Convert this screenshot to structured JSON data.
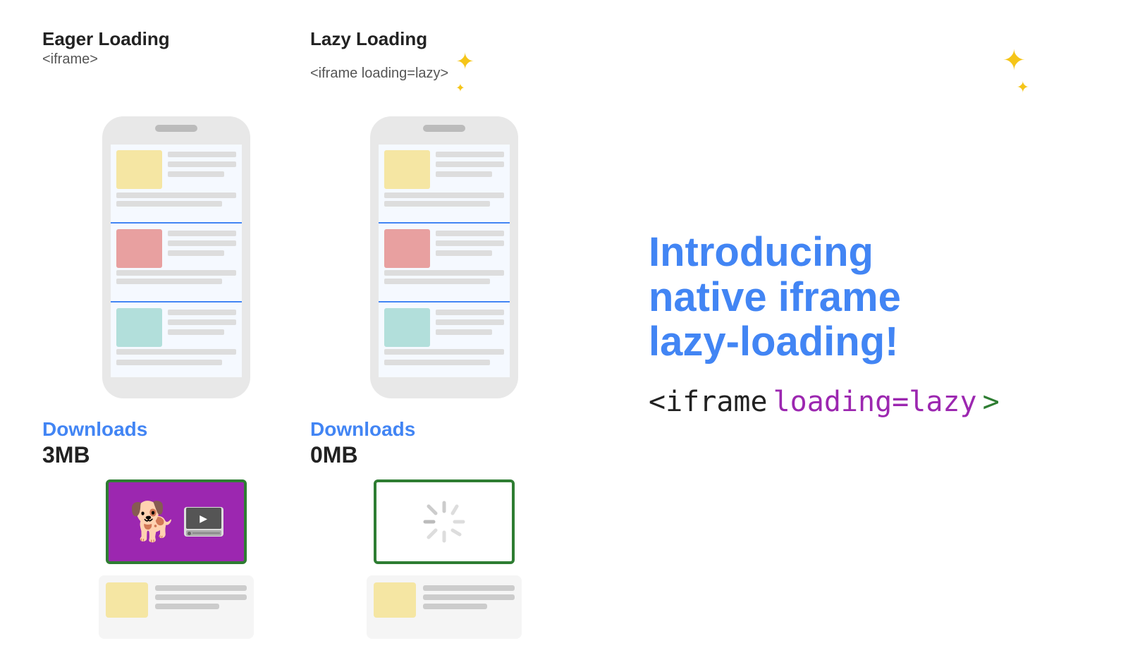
{
  "eager": {
    "title": "Eager Loading",
    "subtitle": "<iframe>",
    "downloads_label": "Downloads",
    "downloads_amount": "3MB"
  },
  "lazy": {
    "title": "Lazy Loading",
    "subtitle": "<iframe loading=lazy>",
    "downloads_label": "Downloads",
    "downloads_amount": "0MB"
  },
  "right": {
    "introducing": "Introducing native iframe lazy-loading!",
    "code_part1": "<iframe",
    "code_part2": "loading=lazy",
    "code_part3": ">"
  }
}
